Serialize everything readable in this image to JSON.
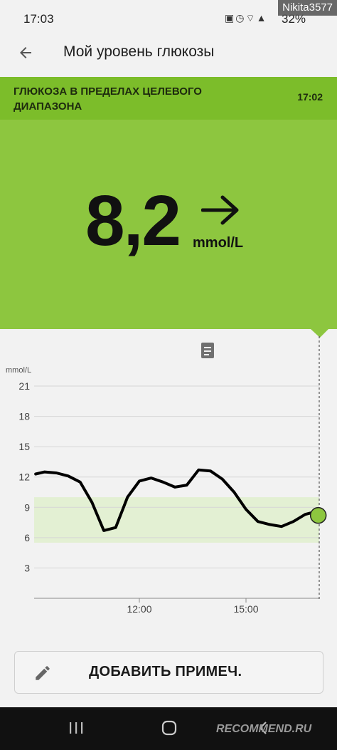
{
  "status_bar": {
    "time": "17:03",
    "battery": "32%",
    "icons": [
      "notification-icon",
      "alarm-icon",
      "vibrate-icon",
      "wifi-icon",
      "signal-icon",
      "battery-icon"
    ]
  },
  "watermark": {
    "username": "Nikita3577",
    "site": "RECOMMEND.RU"
  },
  "header": {
    "title": "Мой уровень глюкозы"
  },
  "banner": {
    "status": "ГЛЮКОЗА В ПРЕДЕЛАХ ЦЕЛЕВОГО ДИАПАЗОНА",
    "time": "17:02"
  },
  "reading": {
    "value": "8,2",
    "unit": "mmol/L",
    "trend": "steady"
  },
  "colors": {
    "banner": "#7cbd2a",
    "reading_bg": "#8dc63f",
    "target_band": "#e3f0d3",
    "current_point": "#8dc63f"
  },
  "chart_data": {
    "type": "line",
    "ylabel": "mmol/L",
    "ylim": [
      0,
      21
    ],
    "y_ticks": [
      "21",
      "18",
      "15",
      "12",
      "9",
      "6",
      "3"
    ],
    "x_ticks": [
      "12:00",
      "15:00"
    ],
    "target_range": [
      5.5,
      10
    ],
    "x": [
      "09:05",
      "09:20",
      "09:40",
      "10:00",
      "10:20",
      "10:40",
      "11:00",
      "11:20",
      "11:40",
      "12:00",
      "12:20",
      "12:40",
      "13:00",
      "13:20",
      "13:40",
      "14:00",
      "14:20",
      "14:40",
      "15:00",
      "15:20",
      "15:40",
      "16:00",
      "16:20",
      "16:40",
      "17:00",
      "17:02"
    ],
    "values": [
      12.3,
      12.5,
      12.4,
      12.1,
      11.5,
      9.5,
      6.7,
      7.0,
      10.0,
      11.6,
      11.9,
      11.5,
      11.0,
      11.2,
      12.7,
      12.6,
      11.8,
      10.5,
      8.8,
      7.6,
      7.3,
      7.1,
      7.6,
      8.3,
      8.6,
      8.2
    ],
    "current": {
      "x": "17:02",
      "value": 8.2
    },
    "grid": true,
    "legend": "none"
  },
  "actions": {
    "add_note_label": "ДОБАВИТЬ ПРИМЕЧ."
  }
}
